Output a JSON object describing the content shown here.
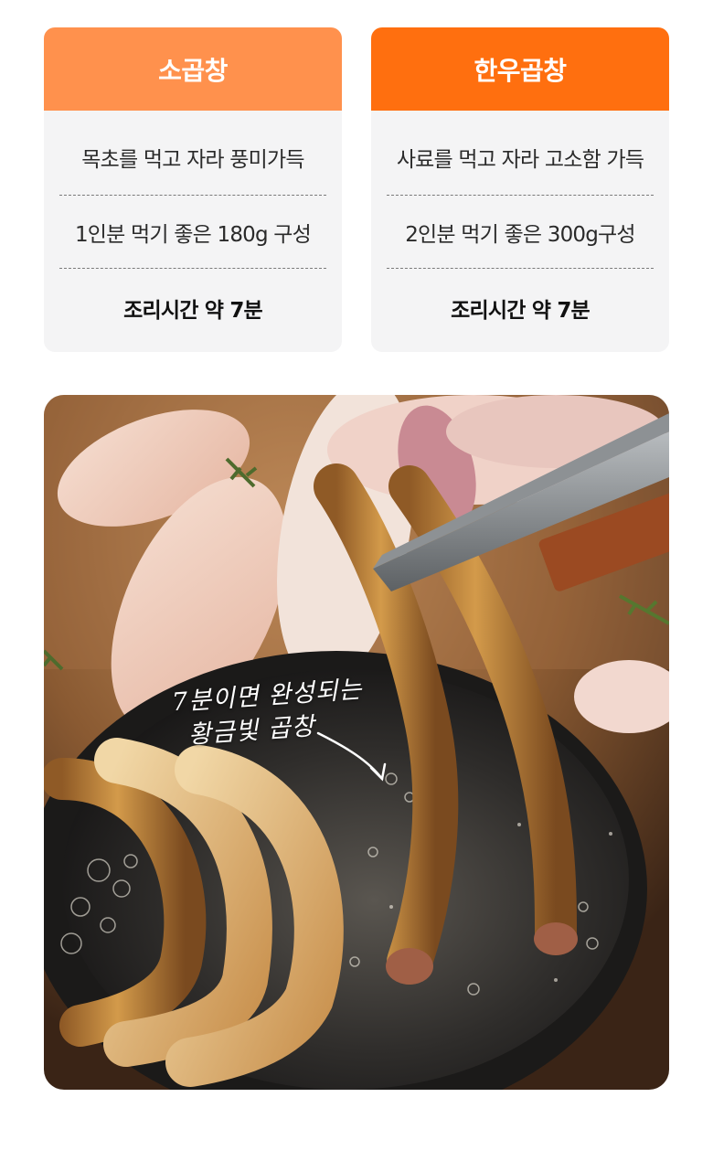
{
  "cards": [
    {
      "title": "소곱창",
      "color": "#ff914d",
      "rows": [
        "목초를 먹고 자라 풍미가득",
        "1인분 먹기 좋은 180g 구성",
        "조리시간 약 7분"
      ]
    },
    {
      "title": "한우곱창",
      "color": "#ff6f0f",
      "rows": [
        "사료를 먹고 자라 고소함 가득",
        "2인분 먹기 좋은 300g구성",
        "조리시간 약 7분"
      ]
    }
  ],
  "photo": {
    "caption_line1": "7분이면 완성되는",
    "caption_line2": "황금빛 곱창"
  },
  "colors": {
    "card_bg": "#f4f4f5",
    "text": "#2a2a2a"
  }
}
